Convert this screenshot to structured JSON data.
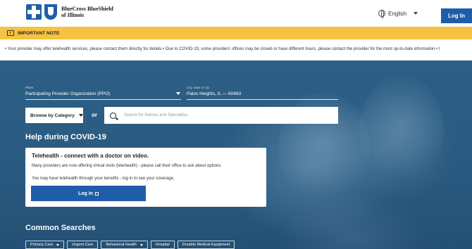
{
  "header": {
    "logo_line1": "BlueCross BlueShield",
    "logo_line2": "of Illinois",
    "language": "English",
    "login_label": "Log In"
  },
  "note": {
    "title": "IMPORTANT NOTE",
    "ticker": "• Your provider may offer telehealth services, please contact them directly for details.• Due to COVID-19, some providers' offices may be closed or have different hours, please contact the provider for the most up-to-date information.• I"
  },
  "search_panel": {
    "plans_label": "Plans",
    "plans_value": "Participating Provider Organization (PPO)",
    "city_label": "City, state or zip",
    "city_value": "Palos Heights, IL — 60463",
    "browse_label": "Browse by Category",
    "or_label": "or",
    "search_placeholder": "Search for Names and Specialties"
  },
  "covid": {
    "heading": "Help during COVID-19",
    "card_title": "Telehealth - connect with a doctor on video.",
    "card_text1": "Many providers are now offering virtual visits (telehealth) - please call their office to ask about options.",
    "card_text2": "You may have telehealth through your benefits - log in to see your coverage.",
    "card_login": "Log In"
  },
  "common": {
    "heading": "Common Searches",
    "chips": [
      {
        "label": "Primary Care",
        "dropdown": true
      },
      {
        "label": "Urgent Care",
        "dropdown": false
      },
      {
        "label": "Behavioral Health",
        "dropdown": true
      },
      {
        "label": "Hospital",
        "dropdown": false
      },
      {
        "label": "Durable Medical Equipment",
        "dropdown": false
      }
    ]
  },
  "colors": {
    "brand_blue": "#1f5da8",
    "note_yellow": "#f5c242",
    "hero_blue": "#2d5f86"
  }
}
